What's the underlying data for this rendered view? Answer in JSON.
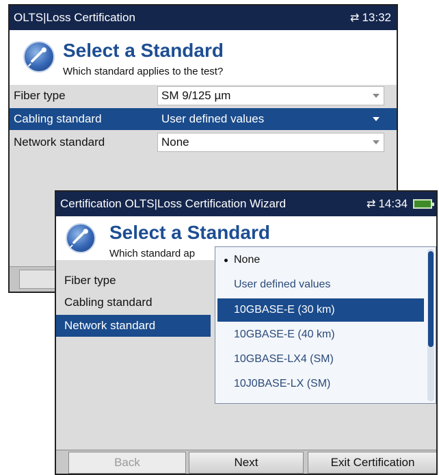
{
  "back_window": {
    "title": "OLTS|Loss Certification",
    "time": "13:32",
    "header_title": "Select a Standard",
    "header_subtitle": "Which standard applies to the test?",
    "fields": [
      {
        "label": "Fiber type",
        "value": "SM 9/125 µm"
      },
      {
        "label": "Cabling standard",
        "value": "User defined values"
      },
      {
        "label": "Network standard",
        "value": "None"
      }
    ]
  },
  "front_window": {
    "title": "Certification OLTS|Loss Certification Wizard",
    "time": "14:34",
    "header_title": "Select a Standard",
    "header_subtitle": "Which standard ap",
    "fields": [
      {
        "label": "Fiber type"
      },
      {
        "label": "Cabling standard"
      },
      {
        "label": "Network standard"
      }
    ],
    "dropdown_options": [
      "None",
      "User defined values",
      "10GBASE-E (30 km)",
      "10GBASE-E (40 km)",
      "10GBASE-LX4 (SM)",
      "10J0BASE-LX (SM)"
    ],
    "buttons": {
      "back": "Back",
      "next": "Next",
      "exit": "Exit Certification"
    }
  },
  "colors": {
    "titlebar": "#15264d",
    "selection": "#1a4b8c",
    "heading": "#1d4e92"
  },
  "icons": [
    "sync-arrows-icon",
    "battery-icon",
    "fiber-connector-logo-icon",
    "dropdown-arrow-icon"
  ]
}
